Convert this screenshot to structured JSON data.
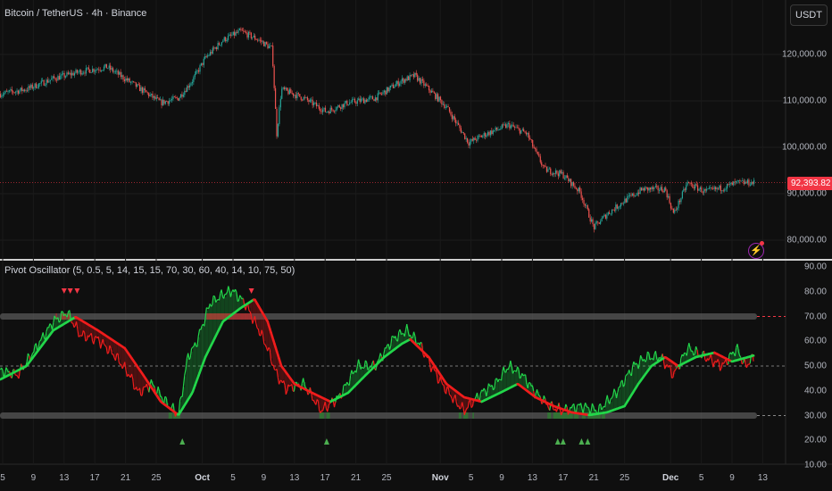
{
  "header": {
    "title": "Bitcoin / TetherUS · 4h · Binance",
    "currency": "USDT"
  },
  "price_axis": {
    "labels": [
      {
        "value": 120000,
        "text": "120,000.00"
      },
      {
        "value": 110000,
        "text": "110,000.00"
      },
      {
        "value": 100000,
        "text": "100,000.00"
      },
      {
        "value": 90000,
        "text": "90,000.00"
      },
      {
        "value": 80000,
        "text": "80,000.00"
      }
    ],
    "last_price": {
      "value": 92393.82,
      "text": "92,393.82"
    }
  },
  "indicator": {
    "title": "Pivot Oscillator (5, 0.5, 5, 14, 15, 15, 70, 30, 60, 40, 14, 10, 75, 50)",
    "axis_labels": [
      "90.00",
      "80.00",
      "70.00",
      "60.00",
      "50.00",
      "40.00",
      "30.00",
      "20.00",
      "10.00"
    ],
    "overbought": 70,
    "oversold": 30,
    "midline": 50
  },
  "time_axis": {
    "labels": [
      {
        "day": 5,
        "text": "5"
      },
      {
        "day": 9,
        "text": "9"
      },
      {
        "day": 13,
        "text": "13"
      },
      {
        "day": 17,
        "text": "17"
      },
      {
        "day": 21,
        "text": "21"
      },
      {
        "day": 25,
        "text": "25"
      },
      {
        "day": 31,
        "text": "Oct",
        "month": true
      },
      {
        "day": 35,
        "text": "5"
      },
      {
        "day": 39,
        "text": "9"
      },
      {
        "day": 43,
        "text": "13"
      },
      {
        "day": 47,
        "text": "17"
      },
      {
        "day": 51,
        "text": "21"
      },
      {
        "day": 55,
        "text": "25"
      },
      {
        "day": 62,
        "text": "Nov",
        "month": true
      },
      {
        "day": 66,
        "text": "5"
      },
      {
        "day": 70,
        "text": "9"
      },
      {
        "day": 74,
        "text": "13"
      },
      {
        "day": 78,
        "text": "17"
      },
      {
        "day": 82,
        "text": "21"
      },
      {
        "day": 86,
        "text": "25"
      },
      {
        "day": 92,
        "text": "Dec",
        "month": true
      },
      {
        "day": 96,
        "text": "5"
      },
      {
        "day": 100,
        "text": "9"
      },
      {
        "day": 104,
        "text": "13"
      }
    ]
  },
  "colors": {
    "up": "#26a69a",
    "down": "#ef5350",
    "osc_green": "#22d64a",
    "osc_red": "#f01c1c",
    "band": "#5d5d5d",
    "accent": "#f23645"
  },
  "chart_data": [
    {
      "type": "candlestick",
      "title": "Bitcoin / TetherUS · 4h · Binance",
      "x_unit": "day since Aug 31",
      "close_path": [
        [
          4.7,
          111500
        ],
        [
          8.1,
          112500
        ],
        [
          11.6,
          114800
        ],
        [
          15.1,
          116300
        ],
        [
          18.6,
          117300
        ],
        [
          22.1,
          113500
        ],
        [
          25.6,
          109600
        ],
        [
          27.9,
          110600
        ],
        [
          29.7,
          114400
        ],
        [
          31.4,
          119200
        ],
        [
          33.7,
          123100
        ],
        [
          36.0,
          125000
        ],
        [
          38.4,
          123100
        ],
        [
          40.1,
          121200
        ],
        [
          40.7,
          102900
        ],
        [
          41.3,
          112500
        ],
        [
          44.2,
          110600
        ],
        [
          47.1,
          107700
        ],
        [
          50.0,
          109600
        ],
        [
          53.5,
          110600
        ],
        [
          57.0,
          114400
        ],
        [
          58.7,
          115400
        ],
        [
          60.5,
          112500
        ],
        [
          62.8,
          108700
        ],
        [
          65.7,
          101000
        ],
        [
          68.0,
          102900
        ],
        [
          70.9,
          104800
        ],
        [
          73.3,
          102900
        ],
        [
          74.4,
          99000
        ],
        [
          75.6,
          95200
        ],
        [
          77.9,
          94200
        ],
        [
          80.2,
          90400
        ],
        [
          82.0,
          82700
        ],
        [
          83.7,
          85600
        ],
        [
          86.0,
          88500
        ],
        [
          88.4,
          91000
        ],
        [
          91.3,
          91000
        ],
        [
          92.4,
          85600
        ],
        [
          94.2,
          92300
        ],
        [
          96.5,
          90400
        ],
        [
          98.8,
          91300
        ],
        [
          100.6,
          92300
        ],
        [
          102.9,
          92394
        ]
      ],
      "ylim": [
        76000,
        128000
      ]
    },
    {
      "type": "line",
      "title": "Pivot Oscillator",
      "ylim": [
        8,
        92
      ],
      "series": [
        {
          "name": "fast",
          "points": [
            [
              4.7,
              48.2
            ],
            [
              7.0,
              46.4
            ],
            [
              9.3,
              57.2
            ],
            [
              11.6,
              68.0
            ],
            [
              13.4,
              71.6
            ],
            [
              15.1,
              62.6
            ],
            [
              17.4,
              60.8
            ],
            [
              19.8,
              53.6
            ],
            [
              21.5,
              46.4
            ],
            [
              22.7,
              39.2
            ],
            [
              24.4,
              42.8
            ],
            [
              26.2,
              35.6
            ],
            [
              27.9,
              30.2
            ],
            [
              29.1,
              53.6
            ],
            [
              30.2,
              59.0
            ],
            [
              32.0,
              75.2
            ],
            [
              33.7,
              78.8
            ],
            [
              34.9,
              80.6
            ],
            [
              36.6,
              75.2
            ],
            [
              38.4,
              64.4
            ],
            [
              39.5,
              57.2
            ],
            [
              40.7,
              46.4
            ],
            [
              41.9,
              41.0
            ],
            [
              44.2,
              42.8
            ],
            [
              46.5,
              32.0
            ],
            [
              48.8,
              37.4
            ],
            [
              51.2,
              50.0
            ],
            [
              53.5,
              50.0
            ],
            [
              55.8,
              60.8
            ],
            [
              57.6,
              64.4
            ],
            [
              59.3,
              59.0
            ],
            [
              60.5,
              51.8
            ],
            [
              62.2,
              42.8
            ],
            [
              64.0,
              35.6
            ],
            [
              65.1,
              32.0
            ],
            [
              67.4,
              39.2
            ],
            [
              69.2,
              42.8
            ],
            [
              70.9,
              50.0
            ],
            [
              72.7,
              46.4
            ],
            [
              74.4,
              39.2
            ],
            [
              76.2,
              33.8
            ],
            [
              77.9,
              32.0
            ],
            [
              80.2,
              33.8
            ],
            [
              82.6,
              32.0
            ],
            [
              84.9,
              39.2
            ],
            [
              87.2,
              50.0
            ],
            [
              88.9,
              53.6
            ],
            [
              90.7,
              53.6
            ],
            [
              92.4,
              46.4
            ],
            [
              94.2,
              57.2
            ],
            [
              96.5,
              53.6
            ],
            [
              98.8,
              50.0
            ],
            [
              100.6,
              57.2
            ],
            [
              101.7,
              50.0
            ],
            [
              102.9,
              53.6
            ]
          ]
        },
        {
          "name": "slow",
          "points": [
            [
              4.7,
              44.6
            ],
            [
              8.1,
              50.0
            ],
            [
              11.6,
              64.4
            ],
            [
              14.5,
              69.8
            ],
            [
              17.4,
              64.4
            ],
            [
              20.9,
              57.2
            ],
            [
              23.3,
              46.4
            ],
            [
              25.6,
              35.6
            ],
            [
              27.9,
              30.2
            ],
            [
              29.7,
              39.2
            ],
            [
              31.4,
              53.6
            ],
            [
              33.7,
              68.0
            ],
            [
              36.0,
              73.4
            ],
            [
              37.8,
              77.0
            ],
            [
              39.5,
              68.0
            ],
            [
              41.3,
              50.0
            ],
            [
              43.0,
              42.8
            ],
            [
              45.3,
              39.2
            ],
            [
              47.7,
              35.6
            ],
            [
              50.0,
              39.2
            ],
            [
              52.3,
              46.4
            ],
            [
              54.7,
              53.6
            ],
            [
              57.0,
              59.0
            ],
            [
              58.1,
              60.8
            ],
            [
              60.5,
              53.6
            ],
            [
              62.8,
              42.8
            ],
            [
              65.1,
              37.4
            ],
            [
              67.4,
              35.6
            ],
            [
              69.8,
              39.2
            ],
            [
              72.1,
              42.8
            ],
            [
              74.4,
              37.4
            ],
            [
              76.8,
              33.8
            ],
            [
              79.1,
              31.3
            ],
            [
              81.4,
              30.2
            ],
            [
              83.7,
              31.3
            ],
            [
              86.0,
              33.8
            ],
            [
              87.8,
              42.8
            ],
            [
              89.5,
              50.0
            ],
            [
              91.3,
              53.6
            ],
            [
              93.0,
              50.0
            ],
            [
              95.3,
              53.6
            ],
            [
              97.7,
              55.4
            ],
            [
              100.0,
              51.8
            ],
            [
              102.9,
              54.3
            ]
          ]
        }
      ],
      "pivot_highs": [
        13.0,
        13.8,
        14.7,
        37.4
      ],
      "pivot_lows": [
        28.4,
        47.2,
        77.3,
        78.0,
        80.4,
        81.2
      ]
    }
  ]
}
